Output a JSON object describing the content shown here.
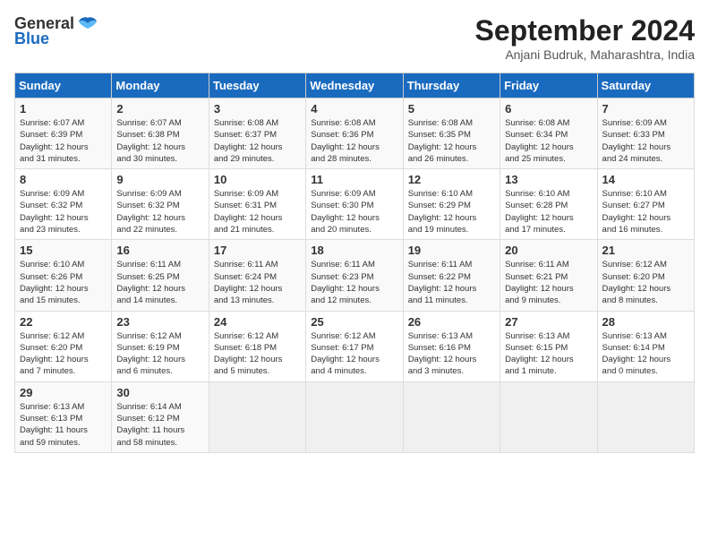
{
  "logo": {
    "general": "General",
    "blue": "Blue"
  },
  "title": "September 2024",
  "location": "Anjani Budruk, Maharashtra, India",
  "days_of_week": [
    "Sunday",
    "Monday",
    "Tuesday",
    "Wednesday",
    "Thursday",
    "Friday",
    "Saturday"
  ],
  "weeks": [
    [
      {
        "day": "1",
        "sunrise": "6:07 AM",
        "sunset": "6:39 PM",
        "daylight": "12 hours and 31 minutes."
      },
      {
        "day": "2",
        "sunrise": "6:07 AM",
        "sunset": "6:38 PM",
        "daylight": "12 hours and 30 minutes."
      },
      {
        "day": "3",
        "sunrise": "6:08 AM",
        "sunset": "6:37 PM",
        "daylight": "12 hours and 29 minutes."
      },
      {
        "day": "4",
        "sunrise": "6:08 AM",
        "sunset": "6:36 PM",
        "daylight": "12 hours and 28 minutes."
      },
      {
        "day": "5",
        "sunrise": "6:08 AM",
        "sunset": "6:35 PM",
        "daylight": "12 hours and 26 minutes."
      },
      {
        "day": "6",
        "sunrise": "6:08 AM",
        "sunset": "6:34 PM",
        "daylight": "12 hours and 25 minutes."
      },
      {
        "day": "7",
        "sunrise": "6:09 AM",
        "sunset": "6:33 PM",
        "daylight": "12 hours and 24 minutes."
      }
    ],
    [
      {
        "day": "8",
        "sunrise": "6:09 AM",
        "sunset": "6:32 PM",
        "daylight": "12 hours and 23 minutes."
      },
      {
        "day": "9",
        "sunrise": "6:09 AM",
        "sunset": "6:32 PM",
        "daylight": "12 hours and 22 minutes."
      },
      {
        "day": "10",
        "sunrise": "6:09 AM",
        "sunset": "6:31 PM",
        "daylight": "12 hours and 21 minutes."
      },
      {
        "day": "11",
        "sunrise": "6:09 AM",
        "sunset": "6:30 PM",
        "daylight": "12 hours and 20 minutes."
      },
      {
        "day": "12",
        "sunrise": "6:10 AM",
        "sunset": "6:29 PM",
        "daylight": "12 hours and 19 minutes."
      },
      {
        "day": "13",
        "sunrise": "6:10 AM",
        "sunset": "6:28 PM",
        "daylight": "12 hours and 17 minutes."
      },
      {
        "day": "14",
        "sunrise": "6:10 AM",
        "sunset": "6:27 PM",
        "daylight": "12 hours and 16 minutes."
      }
    ],
    [
      {
        "day": "15",
        "sunrise": "6:10 AM",
        "sunset": "6:26 PM",
        "daylight": "12 hours and 15 minutes."
      },
      {
        "day": "16",
        "sunrise": "6:11 AM",
        "sunset": "6:25 PM",
        "daylight": "12 hours and 14 minutes."
      },
      {
        "day": "17",
        "sunrise": "6:11 AM",
        "sunset": "6:24 PM",
        "daylight": "12 hours and 13 minutes."
      },
      {
        "day": "18",
        "sunrise": "6:11 AM",
        "sunset": "6:23 PM",
        "daylight": "12 hours and 12 minutes."
      },
      {
        "day": "19",
        "sunrise": "6:11 AM",
        "sunset": "6:22 PM",
        "daylight": "12 hours and 11 minutes."
      },
      {
        "day": "20",
        "sunrise": "6:11 AM",
        "sunset": "6:21 PM",
        "daylight": "12 hours and 9 minutes."
      },
      {
        "day": "21",
        "sunrise": "6:12 AM",
        "sunset": "6:20 PM",
        "daylight": "12 hours and 8 minutes."
      }
    ],
    [
      {
        "day": "22",
        "sunrise": "6:12 AM",
        "sunset": "6:20 PM",
        "daylight": "12 hours and 7 minutes."
      },
      {
        "day": "23",
        "sunrise": "6:12 AM",
        "sunset": "6:19 PM",
        "daylight": "12 hours and 6 minutes."
      },
      {
        "day": "24",
        "sunrise": "6:12 AM",
        "sunset": "6:18 PM",
        "daylight": "12 hours and 5 minutes."
      },
      {
        "day": "25",
        "sunrise": "6:12 AM",
        "sunset": "6:17 PM",
        "daylight": "12 hours and 4 minutes."
      },
      {
        "day": "26",
        "sunrise": "6:13 AM",
        "sunset": "6:16 PM",
        "daylight": "12 hours and 3 minutes."
      },
      {
        "day": "27",
        "sunrise": "6:13 AM",
        "sunset": "6:15 PM",
        "daylight": "12 hours and 1 minute."
      },
      {
        "day": "28",
        "sunrise": "6:13 AM",
        "sunset": "6:14 PM",
        "daylight": "12 hours and 0 minutes."
      }
    ],
    [
      {
        "day": "29",
        "sunrise": "6:13 AM",
        "sunset": "6:13 PM",
        "daylight": "11 hours and 59 minutes."
      },
      {
        "day": "30",
        "sunrise": "6:14 AM",
        "sunset": "6:12 PM",
        "daylight": "11 hours and 58 minutes."
      },
      null,
      null,
      null,
      null,
      null
    ]
  ],
  "labels": {
    "sunrise": "Sunrise:",
    "sunset": "Sunset:",
    "daylight": "Daylight hours"
  }
}
